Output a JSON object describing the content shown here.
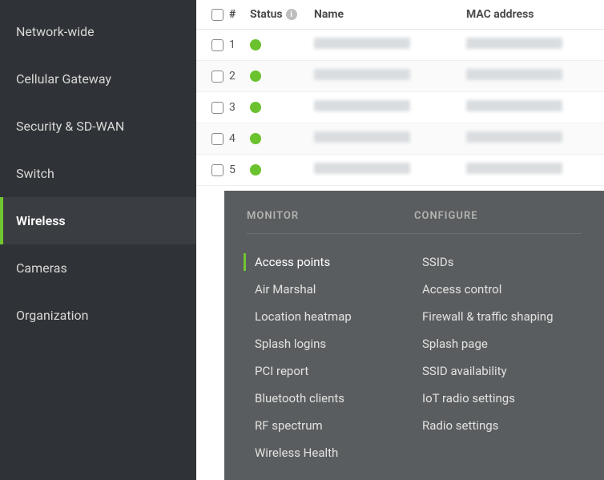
{
  "sidebar": {
    "items": [
      {
        "label": "Network-wide",
        "active": false
      },
      {
        "label": "Cellular Gateway",
        "active": false
      },
      {
        "label": "Security & SD-WAN",
        "active": false
      },
      {
        "label": "Switch",
        "active": false
      },
      {
        "label": "Wireless",
        "active": true
      },
      {
        "label": "Cameras",
        "active": false
      },
      {
        "label": "Organization",
        "active": false
      }
    ]
  },
  "table": {
    "headers": {
      "num": "#",
      "status": "Status",
      "name": "Name",
      "mac": "MAC address"
    },
    "info_icon": "i",
    "rows": [
      {
        "num": "1",
        "status": "online"
      },
      {
        "num": "2",
        "status": "online"
      },
      {
        "num": "3",
        "status": "online"
      },
      {
        "num": "4",
        "status": "online"
      },
      {
        "num": "5",
        "status": "online"
      }
    ]
  },
  "flyout": {
    "columns": [
      {
        "heading": "MONITOR",
        "items": [
          {
            "label": "Access points",
            "active": true
          },
          {
            "label": "Air Marshal",
            "active": false
          },
          {
            "label": "Location heatmap",
            "active": false
          },
          {
            "label": "Splash logins",
            "active": false
          },
          {
            "label": "PCI report",
            "active": false
          },
          {
            "label": "Bluetooth clients",
            "active": false
          },
          {
            "label": "RF spectrum",
            "active": false
          },
          {
            "label": "Wireless Health",
            "active": false
          }
        ]
      },
      {
        "heading": "CONFIGURE",
        "items": [
          {
            "label": "SSIDs",
            "active": false
          },
          {
            "label": "Access control",
            "active": false
          },
          {
            "label": "Firewall & traffic shaping",
            "active": false
          },
          {
            "label": "Splash page",
            "active": false
          },
          {
            "label": "SSID availability",
            "active": false
          },
          {
            "label": "IoT radio settings",
            "active": false
          },
          {
            "label": "Radio settings",
            "active": false
          }
        ]
      }
    ]
  }
}
